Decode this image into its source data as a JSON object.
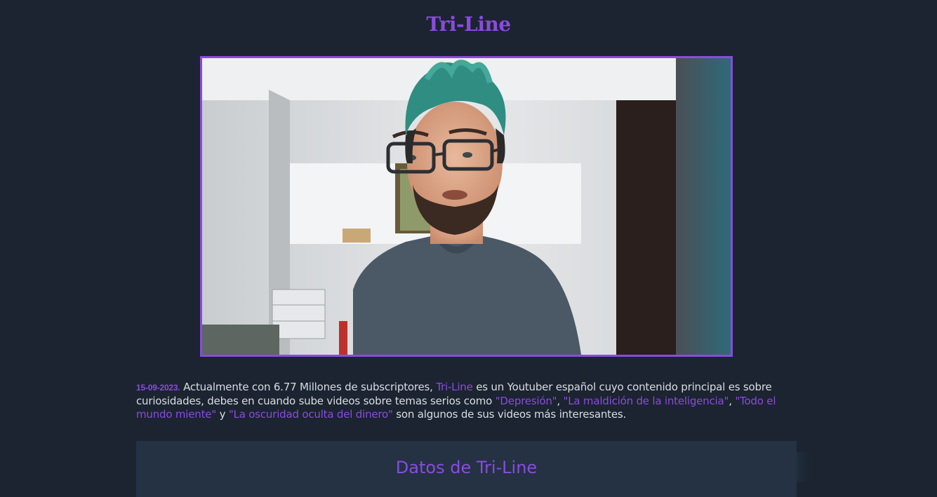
{
  "page": {
    "title": "Tri-Line"
  },
  "photo": {
    "alt": "Tri-Line"
  },
  "description": {
    "date": "15-09-2023.",
    "text1": " Actualmente con 6.77 Millones de subscriptores, ",
    "name": "Tri-Line",
    "text2": " es un Youtuber español cuyo contenido principal es sobre curiosidades, debes en cuando sube videos sobre temas serios como ",
    "videos": [
      "\"Depresión\"",
      "\"La maldición de la inteligencia\"",
      "\"Todo el mundo miente\"",
      "\"La oscuridad oculta del dinero\""
    ],
    "sep1": ", ",
    "sep2": ", ",
    "sep3": " y ",
    "text3": " son algunos de sus videos más interesantes."
  },
  "data_section": {
    "heading": "Datos de Tri-Line"
  },
  "colors": {
    "background": "#1b2430",
    "accent": "#8a4be0",
    "card": "#243243",
    "text": "#d9dde3"
  }
}
